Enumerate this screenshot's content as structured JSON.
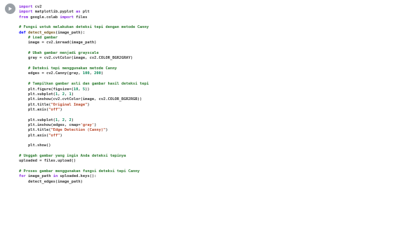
{
  "cell": {
    "run_icon": "play-icon",
    "code_lines": [
      [
        [
          "kw",
          "import"
        ],
        [
          "tx",
          " cv2"
        ]
      ],
      [
        [
          "kw",
          "import"
        ],
        [
          "tx",
          " matplotlib.pyplot "
        ],
        [
          "kw",
          "as"
        ],
        [
          "tx",
          " plt"
        ]
      ],
      [
        [
          "kw",
          "from"
        ],
        [
          "tx",
          " google.colab "
        ],
        [
          "kw",
          "import"
        ],
        [
          "tx",
          " files"
        ]
      ],
      [],
      [
        [
          "cm",
          "# Fungsi untuk melakukan deteksi tepi dengan metode Canny"
        ]
      ],
      [
        [
          "kw2",
          "def"
        ],
        [
          "tx",
          " "
        ],
        [
          "fn",
          "detect_edges"
        ],
        [
          "tx",
          "(image_path):"
        ]
      ],
      [
        [
          "tx",
          "    "
        ],
        [
          "cm",
          "# Load gambar"
        ]
      ],
      [
        [
          "tx",
          "    image = cv2.imread(image_path)"
        ]
      ],
      [],
      [
        [
          "tx",
          "    "
        ],
        [
          "cm",
          "# Ubah gambar menjadi grayscale"
        ]
      ],
      [
        [
          "tx",
          "    gray = cv2.cvtColor(image, cv2.COLOR_BGR2GRAY)"
        ]
      ],
      [],
      [
        [
          "tx",
          "    "
        ],
        [
          "cm",
          "# Deteksi tepi menggunakan metode Canny"
        ]
      ],
      [
        [
          "tx",
          "    edges = cv2.Canny(gray, "
        ],
        [
          "num",
          "100"
        ],
        [
          "tx",
          ", "
        ],
        [
          "num",
          "200"
        ],
        [
          "tx",
          ")"
        ]
      ],
      [],
      [
        [
          "tx",
          "    "
        ],
        [
          "cm",
          "# Tampilkan gambar asli dan gambar hasil deteksi tepi"
        ]
      ],
      [
        [
          "tx",
          "    plt.figure(figsize=("
        ],
        [
          "num",
          "10"
        ],
        [
          "tx",
          ", "
        ],
        [
          "num",
          "5"
        ],
        [
          "tx",
          "))"
        ]
      ],
      [
        [
          "tx",
          "    plt.subplot("
        ],
        [
          "num",
          "1"
        ],
        [
          "tx",
          ", "
        ],
        [
          "num",
          "2"
        ],
        [
          "tx",
          ", "
        ],
        [
          "num",
          "1"
        ],
        [
          "tx",
          ")"
        ]
      ],
      [
        [
          "tx",
          "    plt.imshow(cv2.cvtColor(image, cv2.COLOR_BGR2RGB))"
        ]
      ],
      [
        [
          "tx",
          "    plt.title("
        ],
        [
          "str",
          "\"Original Image\""
        ],
        [
          "tx",
          ")"
        ]
      ],
      [
        [
          "tx",
          "    plt.axis("
        ],
        [
          "str",
          "\"off\""
        ],
        [
          "tx",
          ")"
        ]
      ],
      [],
      [
        [
          "tx",
          "    plt.subplot("
        ],
        [
          "num",
          "1"
        ],
        [
          "tx",
          ", "
        ],
        [
          "num",
          "2"
        ],
        [
          "tx",
          ", "
        ],
        [
          "num",
          "2"
        ],
        [
          "tx",
          ")"
        ]
      ],
      [
        [
          "tx",
          "    plt.imshow(edges, cmap="
        ],
        [
          "str",
          "'gray'"
        ],
        [
          "tx",
          ")"
        ]
      ],
      [
        [
          "tx",
          "    plt.title("
        ],
        [
          "str",
          "\"Edge Detection (Canny)\""
        ],
        [
          "tx",
          ")"
        ]
      ],
      [
        [
          "tx",
          "    plt.axis("
        ],
        [
          "str",
          "\"off\""
        ],
        [
          "tx",
          ")"
        ]
      ],
      [],
      [
        [
          "tx",
          "    plt.show()"
        ]
      ],
      [],
      [
        [
          "cm",
          "# Unggah gambar yang ingin Anda deteksi tepinya"
        ]
      ],
      [
        [
          "tx",
          "uploaded = files.upload()"
        ]
      ],
      [],
      [
        [
          "cm",
          "# Proses gambar menggunakan fungsi deteksi tepi Canny"
        ]
      ],
      [
        [
          "kw",
          "for"
        ],
        [
          "tx",
          " image_path "
        ],
        [
          "kw",
          "in"
        ],
        [
          "tx",
          " uploaded.keys():"
        ]
      ],
      [
        [
          "tx",
          "    detect_edges(image_path)"
        ]
      ]
    ]
  }
}
